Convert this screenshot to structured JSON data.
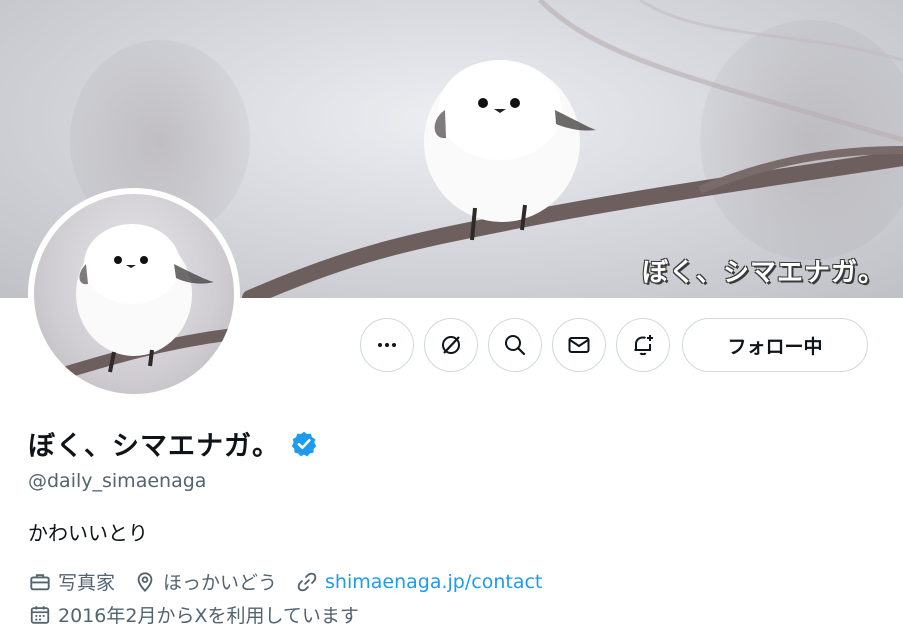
{
  "banner": {
    "watermark": "ぼく、シマエナガ。"
  },
  "profile": {
    "display_name": "ぼく、シマエナガ。",
    "verified": true,
    "handle": "@daily_simaenaga",
    "bio": "かわいいとり",
    "profession": "写真家",
    "location": "ほっかいどう",
    "website": "shimaenaga.jp/contact",
    "joined": "2016年2月からXを利用しています"
  },
  "actions": {
    "more_icon": "more-horizontal-icon",
    "grok_icon": "grok-icon",
    "search_icon": "search-icon",
    "message_icon": "mail-icon",
    "notify_icon": "bell-plus-icon",
    "follow_label": "フォロー中"
  },
  "colors": {
    "link": "#1d9bf0",
    "secondary_text": "#536471",
    "verified_badge": "#1d9bf0",
    "button_border": "#cfd9de"
  }
}
